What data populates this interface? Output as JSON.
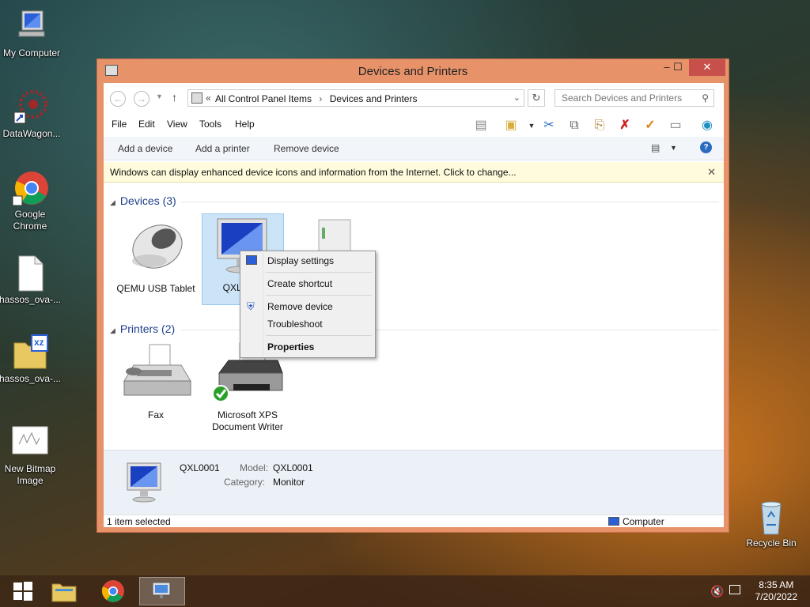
{
  "desktop": {
    "icons": [
      {
        "label": "My Computer"
      },
      {
        "label": "DataWagon..."
      },
      {
        "label": "Google Chrome"
      },
      {
        "label": "hassos_ova-..."
      },
      {
        "label": "hassos_ova-..."
      },
      {
        "label": "New Bitmap Image"
      },
      {
        "label": "Recycle Bin"
      }
    ],
    "xz_badge": "xz"
  },
  "window": {
    "title": "Devices and Printers",
    "controls": {
      "minimize": "–",
      "maximize": "☐",
      "close": "✕"
    },
    "address": {
      "prefix": "«",
      "crumbs": [
        "All Control Panel Items",
        "Devices and Printers"
      ],
      "separator": "›"
    },
    "search": {
      "placeholder": "Search Devices and Printers"
    },
    "menu": [
      "File",
      "Edit",
      "View",
      "Tools",
      "Help"
    ],
    "commands": [
      "Add a device",
      "Add a printer",
      "Remove device"
    ],
    "infobar": "Windows can display enhanced device icons and information from the Internet. Click to change...",
    "groups": {
      "devices": {
        "title": "Devices (3)"
      },
      "printers": {
        "title": "Printers (2)"
      }
    },
    "devices": [
      {
        "label": "QEMU USB Tablet"
      },
      {
        "label": "QXL0001"
      },
      {
        "label": ""
      }
    ],
    "printers": [
      {
        "label": "Fax"
      },
      {
        "label": "Microsoft XPS Document Writer"
      }
    ],
    "details": {
      "name": "QXL0001",
      "model_key": "Model:",
      "model_val": "QXL0001",
      "category_key": "Category:",
      "category_val": "Monitor"
    },
    "status": {
      "left": "1 item selected",
      "right": "Computer"
    }
  },
  "context_menu": {
    "items": [
      "Display settings",
      "Create shortcut",
      "Remove device",
      "Troubleshoot",
      "Properties"
    ]
  },
  "taskbar": {
    "time": "8:35 AM",
    "date": "7/20/2022"
  },
  "colors": {
    "titlebar": "#e8926a",
    "close": "#c7504b",
    "link_blue": "#1e3f8a",
    "infobar": "#fffbdc"
  }
}
